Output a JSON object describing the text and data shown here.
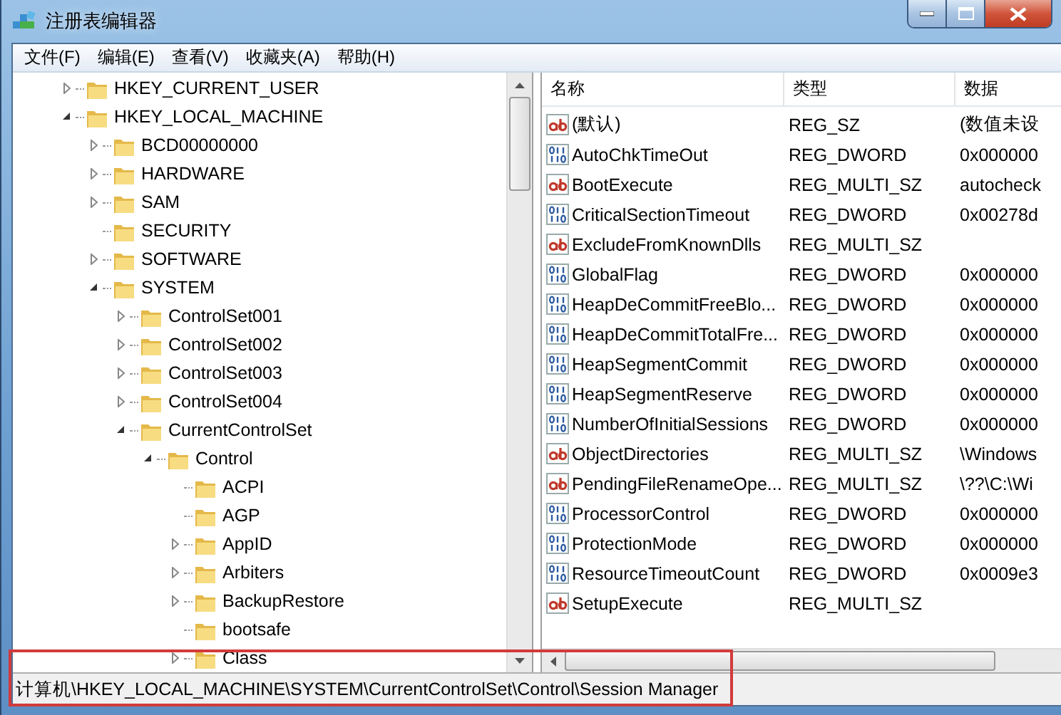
{
  "window": {
    "title": "注册表编辑器"
  },
  "menu": [
    "文件(F)",
    "编辑(E)",
    "查看(V)",
    "收藏夹(A)",
    "帮助(H)"
  ],
  "tree": [
    {
      "label": "HKEY_CURRENT_USER",
      "kind": "branch",
      "expanded": false
    },
    {
      "label": "HKEY_LOCAL_MACHINE",
      "kind": "branch",
      "expanded": true,
      "children": [
        {
          "label": "BCD00000000",
          "kind": "branch",
          "expanded": false
        },
        {
          "label": "HARDWARE",
          "kind": "branch",
          "expanded": false
        },
        {
          "label": "SAM",
          "kind": "branch",
          "expanded": false
        },
        {
          "label": "SECURITY",
          "kind": "leaf"
        },
        {
          "label": "SOFTWARE",
          "kind": "branch",
          "expanded": false
        },
        {
          "label": "SYSTEM",
          "kind": "branch",
          "expanded": true,
          "children": [
            {
              "label": "ControlSet001",
              "kind": "branch",
              "expanded": false
            },
            {
              "label": "ControlSet002",
              "kind": "branch",
              "expanded": false
            },
            {
              "label": "ControlSet003",
              "kind": "branch",
              "expanded": false
            },
            {
              "label": "ControlSet004",
              "kind": "branch",
              "expanded": false
            },
            {
              "label": "CurrentControlSet",
              "kind": "branch",
              "expanded": true,
              "children": [
                {
                  "label": "Control",
                  "kind": "branch",
                  "expanded": true,
                  "children": [
                    {
                      "label": "ACPI",
                      "kind": "leaf"
                    },
                    {
                      "label": "AGP",
                      "kind": "leaf"
                    },
                    {
                      "label": "AppID",
                      "kind": "branch",
                      "expanded": false
                    },
                    {
                      "label": "Arbiters",
                      "kind": "branch",
                      "expanded": false
                    },
                    {
                      "label": "BackupRestore",
                      "kind": "branch",
                      "expanded": false
                    },
                    {
                      "label": "bootsafe",
                      "kind": "leaf"
                    },
                    {
                      "label": "Class",
                      "kind": "branch",
                      "expanded": false
                    }
                  ]
                }
              ]
            }
          ]
        }
      ]
    }
  ],
  "table": {
    "columns": [
      "名称",
      "类型",
      "数据"
    ],
    "rows": [
      {
        "kind": "string",
        "name": "(默认)",
        "type": "REG_SZ",
        "data": "(数值未设"
      },
      {
        "kind": "binary",
        "name": "AutoChkTimeOut",
        "type": "REG_DWORD",
        "data": "0x000000"
      },
      {
        "kind": "string",
        "name": "BootExecute",
        "type": "REG_MULTI_SZ",
        "data": "autocheck"
      },
      {
        "kind": "binary",
        "name": "CriticalSectionTimeout",
        "type": "REG_DWORD",
        "data": "0x00278d"
      },
      {
        "kind": "string",
        "name": "ExcludeFromKnownDlls",
        "type": "REG_MULTI_SZ"
      },
      {
        "kind": "binary",
        "name": "GlobalFlag",
        "type": "REG_DWORD",
        "data": "0x000000"
      },
      {
        "kind": "binary",
        "name": "HeapDeCommitFreeBlo...",
        "type": "REG_DWORD",
        "data": "0x000000"
      },
      {
        "kind": "binary",
        "name": "HeapDeCommitTotalFre...",
        "type": "REG_DWORD",
        "data": "0x000000"
      },
      {
        "kind": "binary",
        "name": "HeapSegmentCommit",
        "type": "REG_DWORD",
        "data": "0x000000"
      },
      {
        "kind": "binary",
        "name": "HeapSegmentReserve",
        "type": "REG_DWORD",
        "data": "0x000000"
      },
      {
        "kind": "binary",
        "name": "NumberOfInitialSessions",
        "type": "REG_DWORD",
        "data": "0x000000"
      },
      {
        "kind": "string",
        "name": "ObjectDirectories",
        "type": "REG_MULTI_SZ",
        "data": "\\Windows"
      },
      {
        "kind": "string",
        "name": "PendingFileRenameOpe...",
        "type": "REG_MULTI_SZ",
        "data": "\\??\\C:\\Wi"
      },
      {
        "kind": "binary",
        "name": "ProcessorControl",
        "type": "REG_DWORD",
        "data": "0x000000"
      },
      {
        "kind": "binary",
        "name": "ProtectionMode",
        "type": "REG_DWORD",
        "data": "0x000000"
      },
      {
        "kind": "binary",
        "name": "ResourceTimeoutCount",
        "type": "REG_DWORD",
        "data": "0x0009e3"
      },
      {
        "kind": "string",
        "name": "SetupExecute",
        "type": "REG_MULTI_SZ"
      }
    ]
  },
  "status_bar": {
    "text": "计算机\\HKEY_LOCAL_MACHINE\\SYSTEM\\CurrentControlSet\\Control\\Session Manager",
    "highlighted": true
  }
}
